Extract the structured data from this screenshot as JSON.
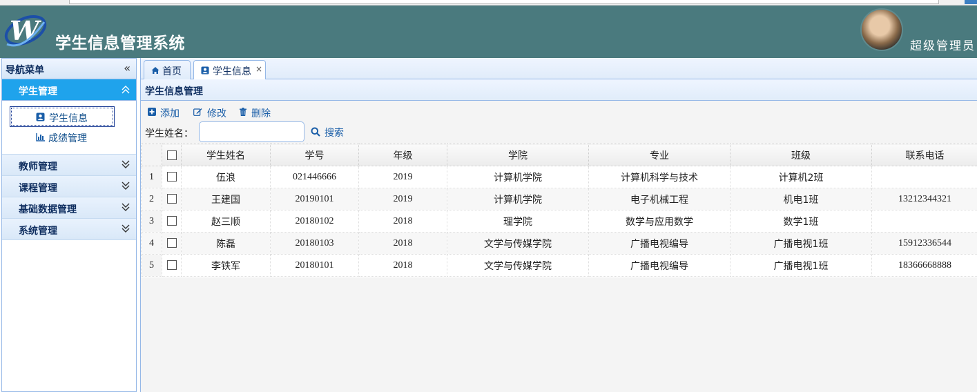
{
  "app": {
    "title": "学生信息管理系统",
    "role": "超级管理员"
  },
  "sidebar": {
    "title": "导航菜单",
    "collapse_glyph": "«",
    "panels": [
      {
        "label": "学生管理",
        "expanded": true,
        "items": [
          {
            "label": "学生信息",
            "icon": "user-card-icon",
            "selected": true
          },
          {
            "label": "成绩管理",
            "icon": "bar-chart-icon",
            "selected": false
          }
        ]
      },
      {
        "label": "教师管理",
        "expanded": false
      },
      {
        "label": "课程管理",
        "expanded": false
      },
      {
        "label": "基础数据管理",
        "expanded": false
      },
      {
        "label": "系统管理",
        "expanded": false
      }
    ]
  },
  "tabs": [
    {
      "label": "首页",
      "icon": "home-icon",
      "active": false,
      "closable": false
    },
    {
      "label": "学生信息",
      "icon": "user-card-icon",
      "active": true,
      "closable": true,
      "close_glyph": "×"
    }
  ],
  "panel": {
    "title": "学生信息管理"
  },
  "toolbar": {
    "add_label": "添加",
    "edit_label": "修改",
    "delete_label": "删除",
    "search_label": "学生姓名：",
    "search_value": "",
    "search_button": "搜索"
  },
  "table": {
    "columns": [
      "学生姓名",
      "学号",
      "年级",
      "学院",
      "专业",
      "班级",
      "联系电话"
    ],
    "rows": [
      {
        "no": "1",
        "name": "伍浪",
        "id": "021446666",
        "grade": "2019",
        "college": "计算机学院",
        "major": "计算机科学与技术",
        "class": "计算机2班",
        "phone": ""
      },
      {
        "no": "2",
        "name": "王建国",
        "id": "20190101",
        "grade": "2019",
        "college": "计算机学院",
        "major": "电子机械工程",
        "class": "机电1班",
        "phone": "13212344321"
      },
      {
        "no": "3",
        "name": "赵三顺",
        "id": "20180102",
        "grade": "2018",
        "college": "理学院",
        "major": "数学与应用数学",
        "class": "数学1班",
        "phone": ""
      },
      {
        "no": "4",
        "name": "陈磊",
        "id": "20180103",
        "grade": "2018",
        "college": "文学与传媒学院",
        "major": "广播电视编导",
        "class": "广播电视1班",
        "phone": "15912336544"
      },
      {
        "no": "5",
        "name": "李铁军",
        "id": "20180101",
        "grade": "2018",
        "college": "文学与传媒学院",
        "major": "广播电视编导",
        "class": "广播电视1班",
        "phone": "18366668888"
      }
    ]
  },
  "colors": {
    "header_bg": "#4a7a7e",
    "active_panel": "#1fa3ec",
    "border": "#95b8e7",
    "link": "#1a5ea8"
  }
}
